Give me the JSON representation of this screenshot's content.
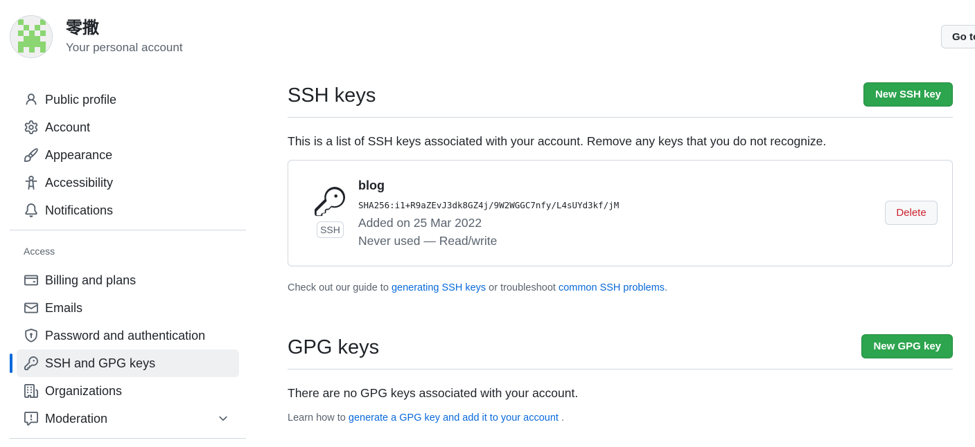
{
  "user": {
    "name": "零撒",
    "subtitle": "Your personal account"
  },
  "header": {
    "goto_label": "Go to"
  },
  "sidebar": {
    "items": [
      {
        "label": "Public profile",
        "icon": "person-icon"
      },
      {
        "label": "Account",
        "icon": "gear-icon"
      },
      {
        "label": "Appearance",
        "icon": "paintbrush-icon"
      },
      {
        "label": "Accessibility",
        "icon": "accessibility-icon"
      },
      {
        "label": "Notifications",
        "icon": "bell-icon"
      }
    ],
    "access_heading": "Access",
    "access_items": [
      {
        "label": "Billing and plans",
        "icon": "credit-card-icon"
      },
      {
        "label": "Emails",
        "icon": "mail-icon"
      },
      {
        "label": "Password and authentication",
        "icon": "shield-lock-icon"
      },
      {
        "label": "SSH and GPG keys",
        "icon": "key-icon",
        "active": true
      },
      {
        "label": "Organizations",
        "icon": "organization-icon"
      },
      {
        "label": "Moderation",
        "icon": "report-icon"
      }
    ]
  },
  "ssh": {
    "title": "SSH keys",
    "new_button": "New SSH key",
    "intro": "This is a list of SSH keys associated with your account. Remove any keys that you do not recognize.",
    "key": {
      "title": "blog",
      "type_label": "SSH",
      "fingerprint": "SHA256:i1+R9aZEvJ3dk8GZ4j/9W2WGGC7nfy/L4sUYd3kf/jM",
      "added": "Added on 25 Mar 2022",
      "used": "Never used — Read/write",
      "delete_label": "Delete"
    },
    "help_prefix": "Check out our guide to ",
    "help_link1": "generating SSH keys",
    "help_mid": " or troubleshoot ",
    "help_link2": "common SSH problems",
    "help_suffix": "."
  },
  "gpg": {
    "title": "GPG keys",
    "new_button": "New GPG key",
    "empty": "There are no GPG keys associated with your account.",
    "help_prefix": "Learn how to ",
    "help_link": "generate a GPG key and add it to your account",
    "help_suffix": " ."
  },
  "colors": {
    "primary_green": "#2da44e",
    "link_blue": "#0969da",
    "danger_red": "#cf222e",
    "active_indicator": "#0969da"
  }
}
